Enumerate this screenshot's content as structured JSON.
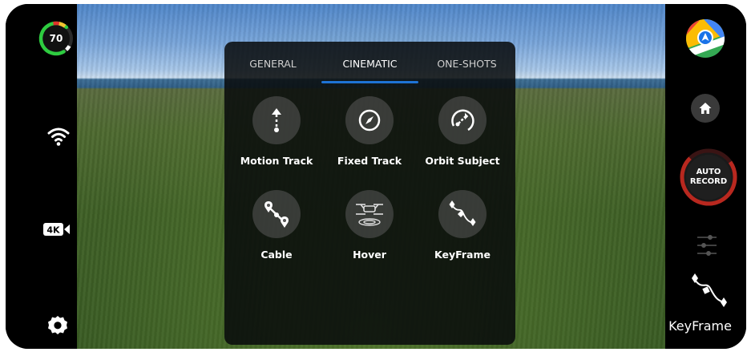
{
  "status": {
    "battery_percent": "70",
    "resolution_label": "4K"
  },
  "menu": {
    "tabs": [
      {
        "label": "GENERAL",
        "active": false
      },
      {
        "label": "CINEMATIC",
        "active": true
      },
      {
        "label": "ONE-SHOTS",
        "active": false
      }
    ],
    "modes": [
      {
        "label": "Motion Track",
        "icon": "motion-track-icon"
      },
      {
        "label": "Fixed Track",
        "icon": "fixed-track-icon"
      },
      {
        "label": "Orbit Subject",
        "icon": "orbit-subject-icon"
      },
      {
        "label": "Cable",
        "icon": "cable-icon"
      },
      {
        "label": "Hover",
        "icon": "hover-icon"
      },
      {
        "label": "KeyFrame",
        "icon": "keyframe-icon"
      }
    ]
  },
  "right_panel": {
    "record_line1": "AUTO",
    "record_line2": "RECORD",
    "selected_mode_label": "KeyFrame"
  },
  "colors": {
    "accent_blue": "#1e73d6",
    "battery_green": "#2ecc40",
    "record_red": "#c0392b"
  }
}
